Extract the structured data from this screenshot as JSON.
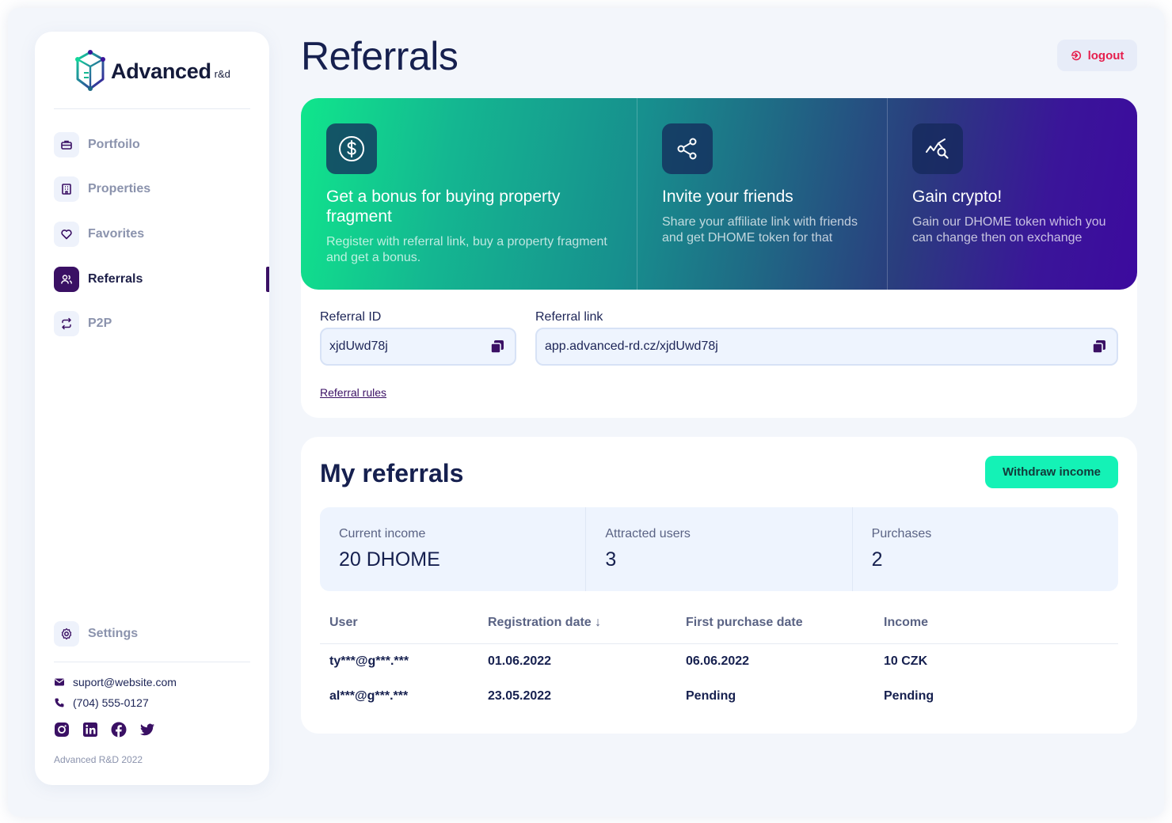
{
  "brand": {
    "name": "Advanced",
    "suffix": "r&d"
  },
  "sidebar": {
    "items": [
      {
        "label": "Portfoilo",
        "icon": "briefcase-icon"
      },
      {
        "label": "Properties",
        "icon": "building-icon"
      },
      {
        "label": "Favorites",
        "icon": "heart-icon"
      },
      {
        "label": "Referrals",
        "icon": "users-icon",
        "active": true
      },
      {
        "label": "P2P",
        "icon": "swap-icon"
      }
    ],
    "settings": {
      "label": "Settings",
      "icon": "gear-icon"
    },
    "email": "suport@website.com",
    "phone": "(704) 555-0127",
    "socials": [
      "instagram-icon",
      "linkedin-icon",
      "facebook-icon",
      "twitter-icon"
    ],
    "copyright": "Advanced R&D 2022"
  },
  "header": {
    "title": "Referrals",
    "logout_label": "logout"
  },
  "banner": [
    {
      "icon": "dollar-icon",
      "title": "Get a bonus for buying property fragment",
      "text": "Register with referral link, buy a property fragment and get a bonus."
    },
    {
      "icon": "share-icon",
      "title": "Invite your friends",
      "text": "Share your affiliate link with friends and get DHOME token for that"
    },
    {
      "icon": "chart-search-icon",
      "title": "Gain crypto!",
      "text": "Gain our DHOME token which you can change then on exchange"
    }
  ],
  "referral": {
    "id_label": "Referral ID",
    "id_value": "xjdUwd78j",
    "link_label": "Referral link",
    "link_value": "app.advanced-rd.cz/xjdUwd78j",
    "rules_label": "Referral rules"
  },
  "my_referrals": {
    "title": "My referrals",
    "withdraw_label": "Withdraw income",
    "stats": [
      {
        "label": "Current income",
        "value": "20 DHOME"
      },
      {
        "label": "Attracted users",
        "value": "3"
      },
      {
        "label": "Purchases",
        "value": "2"
      }
    ],
    "columns": [
      "User",
      "Registration date ↓",
      "First purchase date",
      "Income"
    ],
    "rows": [
      [
        "ty***@g***.***",
        "01.06.2022",
        "06.06.2022",
        "10 CZK"
      ],
      [
        "al***@g***.***",
        "23.05.2022",
        "Pending",
        "Pending"
      ]
    ]
  },
  "colors": {
    "accent": "#3a1064",
    "primary_button": "#14f2b6",
    "logout": "#e61e4d",
    "text_dark": "#16204f",
    "muted": "#8b93ad"
  }
}
